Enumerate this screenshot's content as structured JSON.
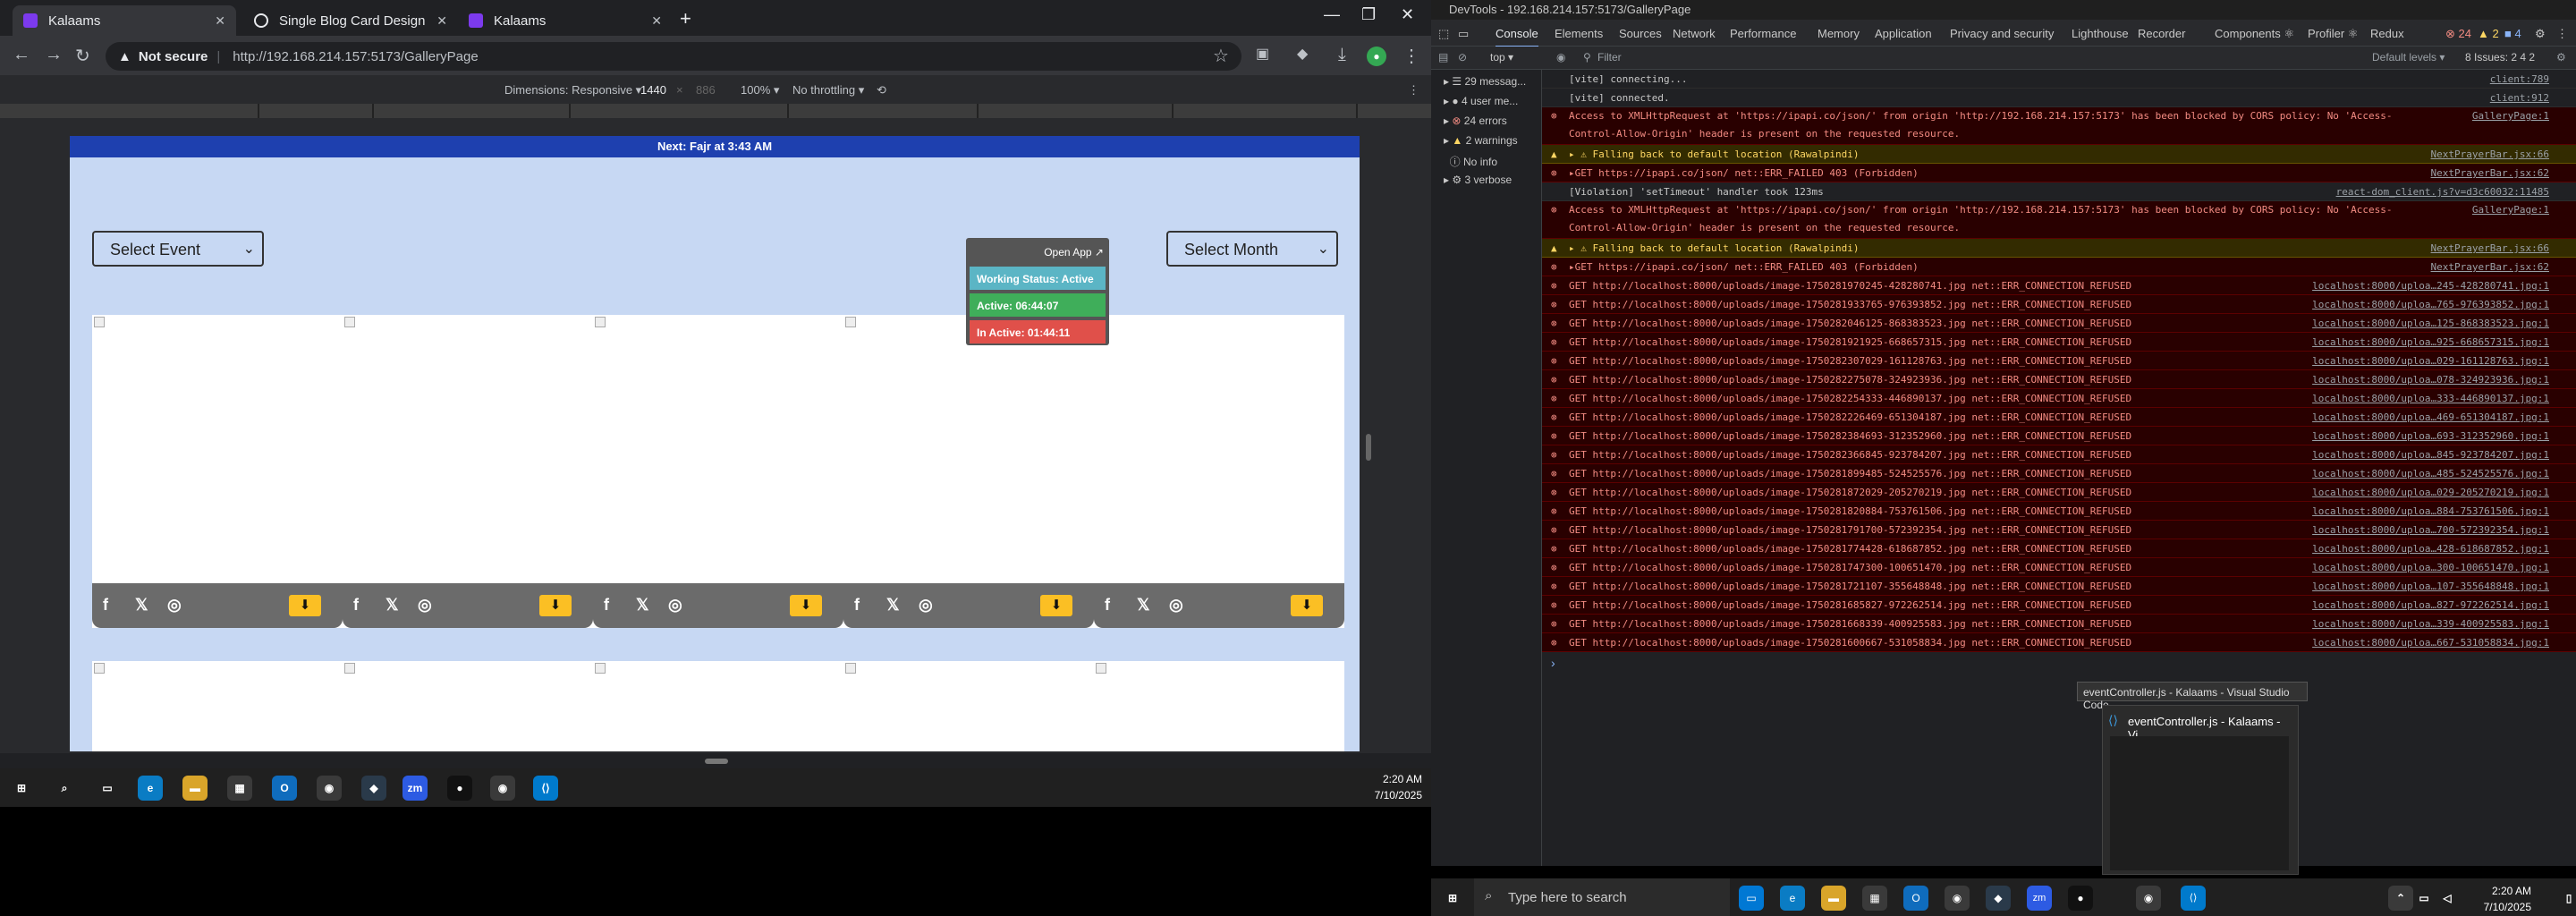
{
  "browser": {
    "tabs": [
      {
        "title": "Kalaams",
        "active": true
      },
      {
        "title": "Single Blog Card Design",
        "active": false
      },
      {
        "title": "Kalaams",
        "active": false
      }
    ],
    "omnibox": {
      "security": "Not secure",
      "url": "http://192.168.214.157:5173/GalleryPage"
    },
    "device_toolbar": {
      "dimensions": "Dimensions: Responsive ▾",
      "width": "1440",
      "height": "886",
      "zoom": "100% ▾",
      "throttle": "No throttling ▾"
    }
  },
  "page": {
    "banner": "Next: Fajr at 3:43 AM",
    "select_event": "Select Event",
    "select_month": "Select Month",
    "popup": {
      "open_app": "Open App ↗",
      "working": "Working Status: Active",
      "active": "Active: 06:44:07",
      "inactive": "In Active: 01:44:11"
    },
    "card_count": 5
  },
  "taskbar_left": {
    "time": "2:20 AM",
    "date": "7/10/2025"
  },
  "devtools": {
    "title": "DevTools - 192.168.214.157:5173/GalleryPage",
    "tabs": [
      "Console",
      "Elements",
      "Sources",
      "Network",
      "Performance",
      "Memory",
      "Application",
      "Privacy and security",
      "Lighthouse",
      "Recorder",
      "Components ⚛",
      "Profiler ⚛",
      "Redux"
    ],
    "badges": {
      "errors": "24",
      "warnings": "2",
      "info": "4",
      "issues": "8 Issues:"
    },
    "toolbar": {
      "context": "top ▾",
      "filter": "Filter",
      "levels": "Default levels ▾",
      "issues": "8 Issues: 2 4 2"
    },
    "sidebar": [
      "29 messag...",
      "4 user me...",
      "24 errors",
      "2 warnings",
      "No info",
      "3 verbose"
    ],
    "logs": [
      {
        "type": "log",
        "text": "[vite] connecting...",
        "src": "client:789"
      },
      {
        "type": "log",
        "text": "[vite] connected.",
        "src": "client:912"
      },
      {
        "type": "err",
        "text": "Access to XMLHttpRequest at 'https://ipapi.co/json/' from origin 'http://192.168.214.157:5173' has been blocked by CORS policy: No 'Access-Control-Allow-Origin' header is present on the requested resource.",
        "src": "GalleryPage:1",
        "tall": true
      },
      {
        "type": "warn",
        "text": "▸ ⚠ Falling back to default location (Rawalpindi)",
        "src": "NextPrayerBar.jsx:66"
      },
      {
        "type": "err",
        "text": "▸GET https://ipapi.co/json/ net::ERR_FAILED 403 (Forbidden)",
        "src": "NextPrayerBar.jsx:62"
      },
      {
        "type": "log",
        "text": "[Violation] 'setTimeout' handler took 123ms",
        "src": "react-dom_client.js?v=d3c60032:11485"
      },
      {
        "type": "err",
        "text": "Access to XMLHttpRequest at 'https://ipapi.co/json/' from origin 'http://192.168.214.157:5173' has been blocked by CORS policy: No 'Access-Control-Allow-Origin' header is present on the requested resource.",
        "src": "GalleryPage:1",
        "tall": true
      },
      {
        "type": "warn",
        "text": "▸ ⚠ Falling back to default location (Rawalpindi)",
        "src": "NextPrayerBar.jsx:66"
      },
      {
        "type": "err",
        "text": "▸GET https://ipapi.co/json/ net::ERR_FAILED 403 (Forbidden)",
        "src": "NextPrayerBar.jsx:62"
      }
    ],
    "get_errors": [
      [
        "1750281970245-428280741",
        "localhost:8000/uploa…245-428280741.jpg:1"
      ],
      [
        "1750281933765-976393852",
        "localhost:8000/uploa…765-976393852.jpg:1"
      ],
      [
        "1750282046125-868383523",
        "localhost:8000/uploa…125-868383523.jpg:1"
      ],
      [
        "1750281921925-668657315",
        "localhost:8000/uploa…925-668657315.jpg:1"
      ],
      [
        "1750282307029-161128763",
        "localhost:8000/uploa…029-161128763.jpg:1"
      ],
      [
        "1750282275078-324923936",
        "localhost:8000/uploa…078-324923936.jpg:1"
      ],
      [
        "1750282254333-446890137",
        "localhost:8000/uploa…333-446890137.jpg:1"
      ],
      [
        "1750282226469-651304187",
        "localhost:8000/uploa…469-651304187.jpg:1"
      ],
      [
        "1750282384693-312352960",
        "localhost:8000/uploa…693-312352960.jpg:1"
      ],
      [
        "1750282366845-923784207",
        "localhost:8000/uploa…845-923784207.jpg:1"
      ],
      [
        "1750281899485-524525576",
        "localhost:8000/uploa…485-524525576.jpg:1"
      ],
      [
        "1750281872029-205270219",
        "localhost:8000/uploa…029-205270219.jpg:1"
      ],
      [
        "1750281820884-753761506",
        "localhost:8000/uploa…884-753761506.jpg:1"
      ],
      [
        "1750281791700-572392354",
        "localhost:8000/uploa…700-572392354.jpg:1"
      ],
      [
        "1750281774428-618687852",
        "localhost:8000/uploa…428-618687852.jpg:1"
      ],
      [
        "1750281747300-100651470",
        "localhost:8000/uploa…300-100651470.jpg:1"
      ],
      [
        "1750281721107-355648848",
        "localhost:8000/uploa…107-355648848.jpg:1"
      ],
      [
        "1750281685827-972262514",
        "localhost:8000/uploa…827-972262514.jpg:1"
      ],
      [
        "1750281668339-400925583",
        "localhost:8000/uploa…339-400925583.jpg:1"
      ],
      [
        "1750281600667-531058834",
        "localhost:8000/uploa…667-531058834.jpg:1"
      ]
    ],
    "get_prefix": "GET http://localhost:8000/uploads/image-",
    "get_suffix": ".jpg net::ERR_CONNECTION_REFUSED",
    "prompt": "›"
  },
  "preview": {
    "tooltip": "eventController.js - Kalaams - Visual Studio Code",
    "title": "eventController.js - Kalaams - Vi..."
  },
  "taskbar_right": {
    "search": "Type here to search",
    "time": "2:20 AM",
    "date": "7/10/2025"
  }
}
